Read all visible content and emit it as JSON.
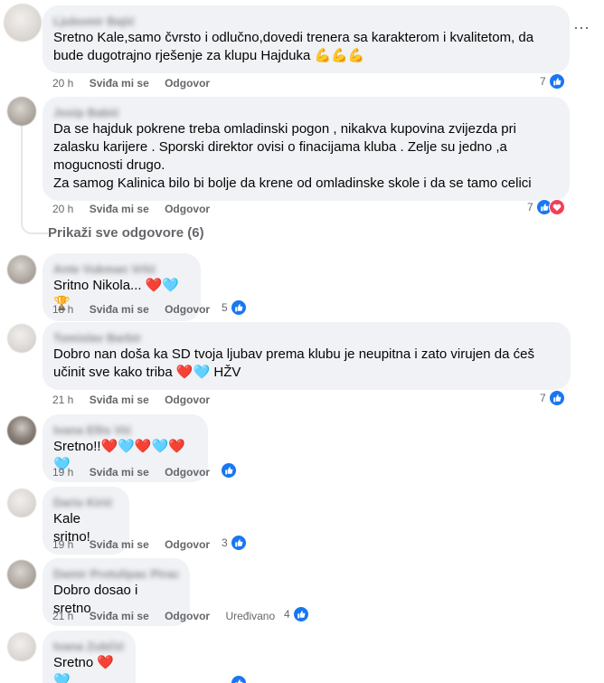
{
  "colors": {
    "like": "#1877f2",
    "love": "#f33e58",
    "bubble": "#f0f2f5",
    "meta": "#65676b"
  },
  "actions": {
    "like": "Sviđa mi se",
    "reply": "Odgovor"
  },
  "show_more_replies": "Prikaži sve odgovore (6)",
  "more_icon": "⋯",
  "comments": [
    {
      "author": "Ljubomir Bajić",
      "text": "Sretno Kale,samo čvrsto i odlučno,dovedi trenera sa karakterom i kvalitetom, da bude dugotrajno rješenje za klupu Hajduka 💪💪💪",
      "time": "20 h",
      "reactions": "7",
      "reaction_icons": [
        "like-icon"
      ]
    },
    {
      "author": "Josip Babić",
      "text": "Da se hajduk pokrene treba omladinski pogon , nikakva kupovina zvijezda pri zalasku karijere . Sporski direktor ovisi o finacijama kluba . Zelje su jedno ,a mogucnosti drugo.\nZa samog Kalinica bilo bi bolje da krene od omladinske skole i da se tamo celici",
      "time": "20 h",
      "reactions": "7",
      "reaction_icons": [
        "like-icon",
        "heart-icon"
      ]
    },
    {
      "author": "Ante Vukman Vrlić",
      "text": "Sritno Nikola... ❤️🩵🏆",
      "time": "18 h",
      "reactions": "5",
      "reaction_icons": [
        "like-icon"
      ]
    },
    {
      "author": "Tomislav Barbir",
      "text": "Dobro nan doša ka SD tvoja ljubav prema klubu je neupitna i zato virujen da ćeš učinit sve kako triba ❤️🩵 HŽV",
      "time": "21 h",
      "reactions": "7",
      "reaction_icons": [
        "like-icon"
      ]
    },
    {
      "author": "Ivana Ellis Vić",
      "text": "Sretno!!❤️🩵❤️🩵❤️🩵",
      "time": "19 h",
      "reactions": "",
      "reaction_icons": [
        "like-icon"
      ]
    },
    {
      "author": "Dario Kirić",
      "text": "Kale sritno!",
      "time": "19 h",
      "reactions": "3",
      "reaction_icons": [
        "like-icon"
      ]
    },
    {
      "author": "Damir Protulipac Pirac",
      "text": "Dobro dosao i sretno",
      "time": "21 h",
      "edited": "Uređivano",
      "reactions": "4",
      "reaction_icons": [
        "like-icon"
      ]
    },
    {
      "author": "Ivana Zubčić",
      "text": "Sretno ❤️🩵",
      "time": "",
      "reactions": "",
      "reaction_icons": [
        "like-icon"
      ]
    }
  ]
}
